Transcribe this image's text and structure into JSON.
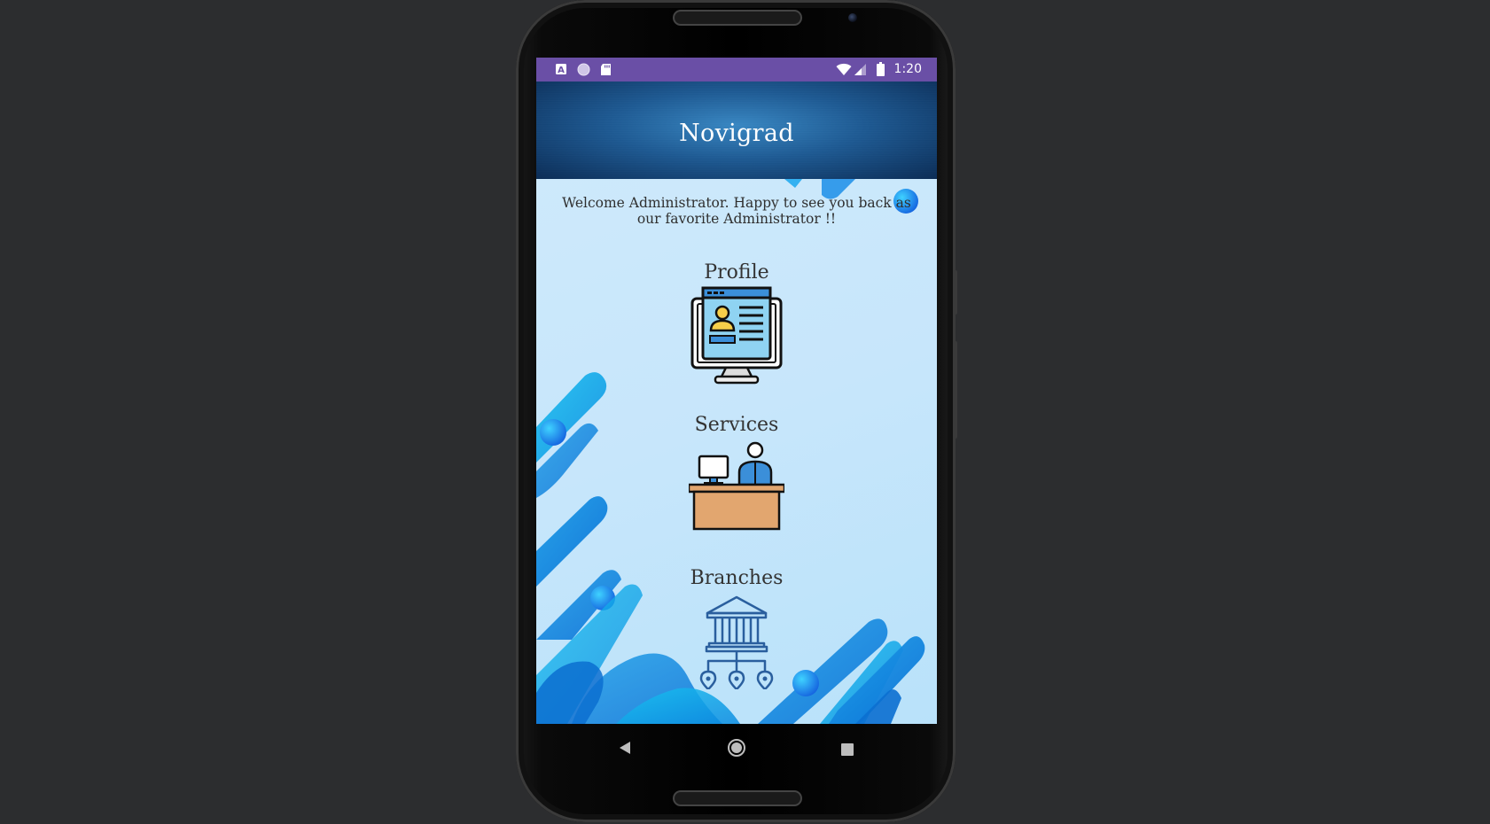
{
  "status_bar": {
    "time": "1:20",
    "icons": [
      "a-letter-icon",
      "circle-icon",
      "sd-card-icon",
      "wifi-icon",
      "signal-icon",
      "battery-icon"
    ]
  },
  "app_bar": {
    "title": "Novigrad"
  },
  "welcome_message": "Welcome Administrator. Happy to see you back as our favorite Administrator !!",
  "menu": {
    "profile_label": "Profile",
    "services_label": "Services",
    "branches_label": "Branches"
  },
  "nav_bar": {
    "icons": [
      "back-icon",
      "home-icon",
      "recents-icon"
    ]
  },
  "colors": {
    "status_bar": "#6a4fa6",
    "app_bar": "#1d5a8f",
    "background": "#c7e6fb",
    "accent_blue": "#1e88e5",
    "desk": "#e2a66f"
  }
}
